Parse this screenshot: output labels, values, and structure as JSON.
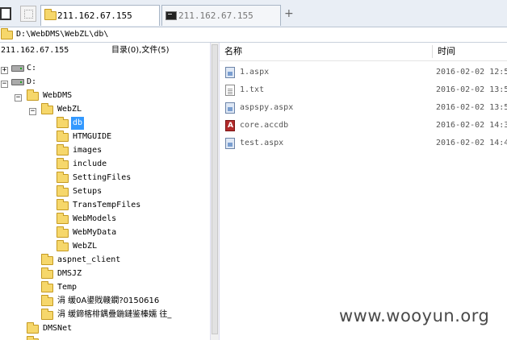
{
  "tabs": [
    {
      "label": "211.162.67.155",
      "icon": "folder-icon",
      "active": true
    },
    {
      "label": "211.162.67.155",
      "icon": "terminal-icon",
      "active": false
    }
  ],
  "new_tab_symbol": "+",
  "path": "D:\\WebDMS\\WebZL\\db\\",
  "left_panel": {
    "host": "211.162.67.155",
    "counts": "目录(0),文件(5)",
    "tree": {
      "drive_c": {
        "label": "C:",
        "toggle": "+"
      },
      "drive_d": {
        "label": "D:",
        "toggle": "−"
      },
      "webdms": {
        "label": "WebDMS",
        "toggle": "−"
      },
      "webzl": {
        "label": "WebZL",
        "toggle": "−"
      },
      "db": {
        "label": "db"
      },
      "htmguide": {
        "label": "HTMGUIDE"
      },
      "images": {
        "label": "images"
      },
      "include": {
        "label": "include"
      },
      "settingfiles": {
        "label": "SettingFiles"
      },
      "setups": {
        "label": "Setups"
      },
      "transtempfiles": {
        "label": "TransTempFiles"
      },
      "webmodels": {
        "label": "WebModels"
      },
      "webmydata": {
        "label": "WebMyData"
      },
      "webzl2": {
        "label": "WebZL"
      },
      "aspnet_client": {
        "label": "aspnet_client"
      },
      "dmsjz": {
        "label": "DMSJZ"
      },
      "temp": {
        "label": "Temp"
      },
      "garbled1": {
        "label": "涓   缓0A鍙戝竷鐗?0150616"
      },
      "garbled2": {
        "label": "涓   缓鍗楁棑鍝疊鍦鏈鉴榛嬬  往_"
      },
      "dmsnet": {
        "label": "DMSNet"
      }
    }
  },
  "right_panel": {
    "headers": {
      "name": "名称",
      "time": "时间"
    },
    "files": [
      {
        "name": "1.aspx",
        "time": "2016-02-02 12:5",
        "type": "aspx"
      },
      {
        "name": "1.txt",
        "time": "2016-02-02 13:5",
        "type": "txt"
      },
      {
        "name": "aspspy.aspx",
        "time": "2016-02-02 13:5",
        "type": "aspx"
      },
      {
        "name": "core.accdb",
        "time": "2016-02-02 14:3",
        "type": "accdb"
      },
      {
        "name": "test.aspx",
        "time": "2016-02-02 14:4",
        "type": "aspx"
      }
    ]
  },
  "watermark": "www.wooyun.org",
  "colors": {
    "selection": "#3399ff",
    "folder": "#f6d76b",
    "tabstrip": "#e9eef5"
  }
}
